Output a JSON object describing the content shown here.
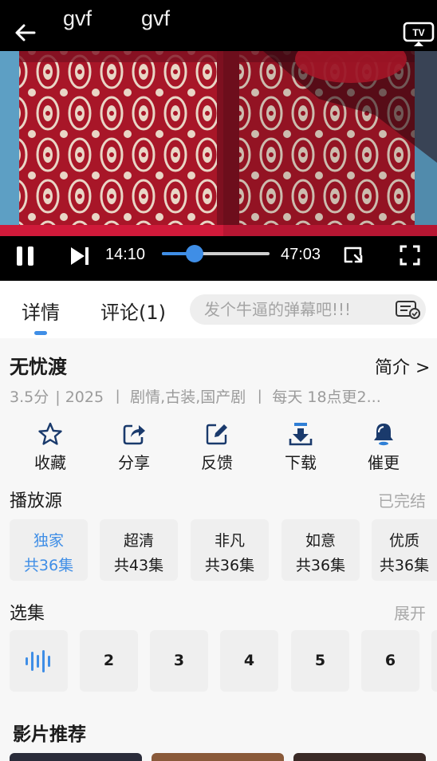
{
  "player": {
    "title_segments": [
      "gvf",
      "gvf"
    ],
    "current_time": "14:10",
    "total_time": "47:03",
    "progress_fraction": 0.3,
    "tv_label": "TV"
  },
  "tabs": {
    "detail": "详情",
    "comments": "评论(1)",
    "danmaku_placeholder": "发个牛逼的弹幕吧!!!"
  },
  "show": {
    "title": "无忧渡",
    "intro_link": "简介 >",
    "meta": [
      "3.5分",
      "| 2025",
      "丨 剧情,古装,国产剧",
      "丨 每天 18点更2..."
    ]
  },
  "actions": [
    {
      "label": "收藏",
      "icon": "star-icon"
    },
    {
      "label": "分享",
      "icon": "share-icon"
    },
    {
      "label": "反馈",
      "icon": "edit-icon"
    },
    {
      "label": "下载",
      "icon": "download-icon"
    },
    {
      "label": "催更",
      "icon": "bell-icon"
    }
  ],
  "sources": {
    "title": "播放源",
    "status": "已完结",
    "items": [
      {
        "name": "独家",
        "count": "共36集"
      },
      {
        "name": "超清",
        "count": "共43集"
      },
      {
        "name": "非凡",
        "count": "共36集"
      },
      {
        "name": "如意",
        "count": "共36集"
      },
      {
        "name": "优质",
        "count": "共36集"
      }
    ]
  },
  "episodes": {
    "title": "选集",
    "expand": "展开",
    "items": [
      "2",
      "3",
      "4",
      "5",
      "6"
    ]
  },
  "recommend": {
    "title": "影片推荐"
  },
  "colors": {
    "accent": "#3f8ee6",
    "chip_bg": "#efefef",
    "page_bg": "#f7f7f7"
  }
}
